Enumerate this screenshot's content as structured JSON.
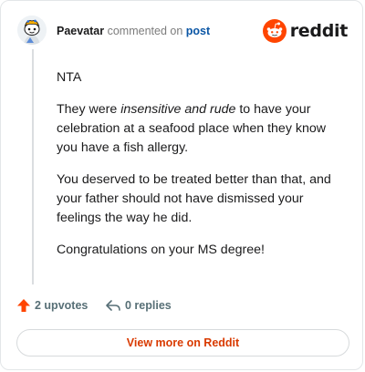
{
  "header": {
    "username": "Paevatar",
    "action_text": "commented on",
    "post_link": "post",
    "logo_text": "reddit",
    "avatar_icon": "snoo-avatar-icon",
    "logo_icon": "reddit-snoo-icon"
  },
  "comment": {
    "paragraph_1": "NTA",
    "paragraph_2_before": "They were ",
    "paragraph_2_emphasis": "insensitive and rude",
    "paragraph_2_after": " to have your celebration at a seafood place when they know you have a fish allergy.",
    "paragraph_3": "You deserved to be treated better than that, and your father should not have dismissed your feelings the way he did.",
    "paragraph_4": "Congratulations on your MS degree!"
  },
  "footer": {
    "upvotes_label": "2 upvotes",
    "replies_label": "0 replies",
    "upvote_icon": "upvote-arrow-icon",
    "reply_icon": "reply-arrow-icon"
  },
  "view_more_label": "View more on Reddit",
  "colors": {
    "brand_orange": "#ff4500",
    "link_blue": "#0b56a5",
    "view_more_text": "#d93a00",
    "muted_text": "#576f76"
  }
}
